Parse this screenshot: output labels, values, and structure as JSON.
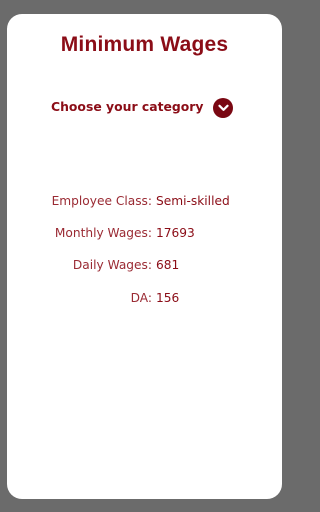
{
  "app": {
    "title": "Minimum Wages"
  },
  "category": {
    "label": "Choose your category",
    "icon": "chevron-down-circle-icon",
    "expanded": false
  },
  "details": [
    {
      "label": "Employee Class:",
      "value": "Semi-skilled"
    },
    {
      "label": "Monthly Wages:",
      "value": "17693"
    },
    {
      "label": "Daily Wages:",
      "value": "681"
    },
    {
      "label": "DA:",
      "value": "156"
    }
  ],
  "colors": {
    "accent": "#8b0d17",
    "background": "#6b6b6b",
    "card": "#ffffff"
  }
}
